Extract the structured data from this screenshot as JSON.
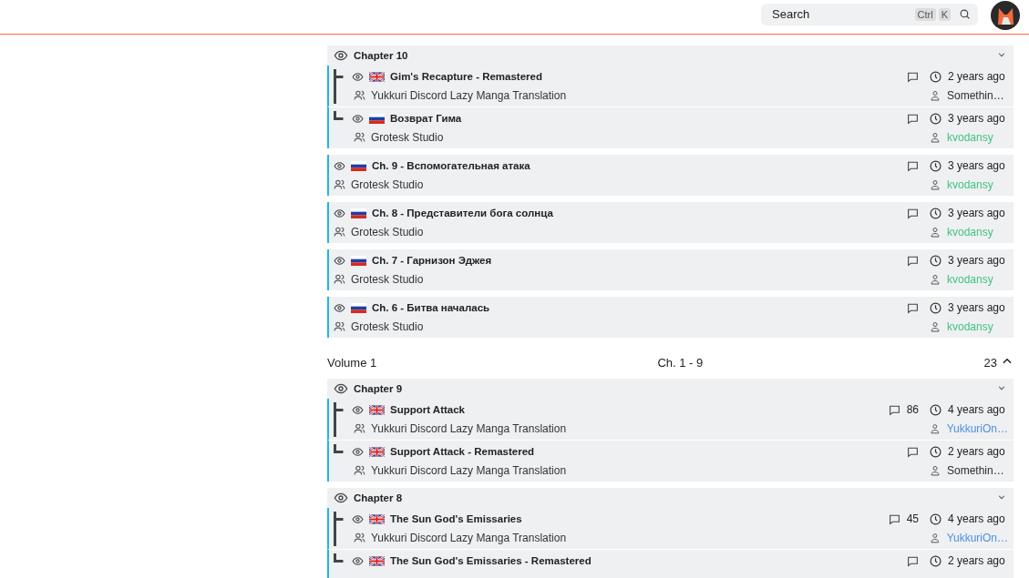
{
  "header": {
    "search": {
      "placeholder": "Search",
      "keys": [
        "Ctrl",
        "K"
      ]
    }
  },
  "feed": [
    {
      "kind": "group",
      "title": "Chapter 10",
      "expanded": true,
      "releases": [
        {
          "kind": "english",
          "title": "Gim's Recapture - Remastered",
          "group": "Yukkuri Discord Lazy Manga Translation",
          "time": "2 years ago",
          "uploader": "Somethin…",
          "color": "#2c2c2c"
        },
        {
          "kind": "russian",
          "title": "Возврат Гима",
          "group": "Grotesk Studio",
          "time": "3 years ago",
          "uploader": "kvodansy",
          "color": "#3fc380"
        }
      ]
    },
    {
      "kind": "single",
      "release": {
        "kind": "russian",
        "title": "Ch. 9 - Вспомогательная атака",
        "group": "Grotesk Studio",
        "time": "3 years ago",
        "uploader": "kvodansy",
        "color": "#3fc380"
      }
    },
    {
      "kind": "single",
      "release": {
        "kind": "russian",
        "title": "Ch. 8 - Представители бога солнца",
        "group": "Grotesk Studio",
        "time": "3 years ago",
        "uploader": "kvodansy",
        "color": "#3fc380"
      }
    },
    {
      "kind": "single",
      "release": {
        "kind": "russian",
        "title": "Ch. 7 - Гарнизон Эджея",
        "group": "Grotesk Studio",
        "time": "3 years ago",
        "uploader": "kvodansy",
        "color": "#3fc380"
      }
    },
    {
      "kind": "single",
      "release": {
        "kind": "russian",
        "title": "Ch. 6 - Битва началась",
        "group": "Grotesk Studio",
        "time": "3 years ago",
        "uploader": "kvodansy",
        "color": "#3fc380"
      }
    },
    {
      "kind": "volume",
      "label": "Volume 1",
      "range": "Ch. 1 - 9",
      "count": "23",
      "expanded": true
    },
    {
      "kind": "group",
      "title": "Chapter 9",
      "expanded": true,
      "releases": [
        {
          "kind": "english",
          "title": "Support Attack",
          "group": "Yukkuri Discord Lazy Manga Translation",
          "comments": "86",
          "time": "4 years ago",
          "uploader": "YukkuriOn…",
          "color": "#4a90e2"
        },
        {
          "kind": "english",
          "title": "Support Attack - Remastered",
          "group": "Yukkuri Discord Lazy Manga Translation",
          "time": "2 years ago",
          "uploader": "Somethin…",
          "color": "#2c2c2c"
        }
      ]
    },
    {
      "kind": "group",
      "title": "Chapter 8",
      "expanded": true,
      "releases": [
        {
          "kind": "english",
          "title": "The Sun God's Emissaries",
          "group": "Yukkuri Discord Lazy Manga Translation",
          "comments": "45",
          "time": "4 years ago",
          "uploader": "YukkuriOn…",
          "color": "#4a90e2"
        },
        {
          "kind": "english",
          "title": "The Sun God's Emissaries - Remastered",
          "time": "2 years ago"
        }
      ]
    }
  ]
}
